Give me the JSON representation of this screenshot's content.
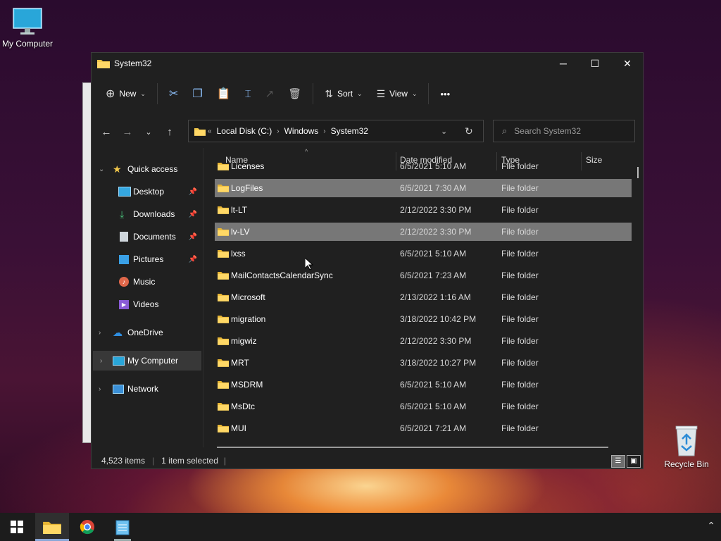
{
  "desktop": {
    "my_computer_label": "My Computer",
    "recycle_bin_label": "Recycle Bin"
  },
  "window": {
    "title": "System32",
    "minimize": "─",
    "maximize": "☐",
    "close": "✕"
  },
  "toolbar": {
    "new_label": "New",
    "sort_label": "Sort",
    "view_label": "View",
    "more": "•••"
  },
  "address": {
    "overflow": "«",
    "crumbs": [
      "Local Disk (C:)",
      "Windows",
      "System32"
    ]
  },
  "search": {
    "placeholder": "Search System32"
  },
  "sidebar": {
    "quick_access": "Quick access",
    "items": [
      {
        "label": "Desktop",
        "pinned": true
      },
      {
        "label": "Downloads",
        "pinned": true
      },
      {
        "label": "Documents",
        "pinned": true
      },
      {
        "label": "Pictures",
        "pinned": true
      },
      {
        "label": "Music",
        "pinned": false
      },
      {
        "label": "Videos",
        "pinned": false
      }
    ],
    "onedrive": "OneDrive",
    "my_computer": "My Computer",
    "network": "Network"
  },
  "columns": {
    "name": "Name",
    "date": "Date modified",
    "type": "Type",
    "size": "Size"
  },
  "files": [
    {
      "name": "Licenses",
      "date": "6/5/2021 5:10 AM",
      "type": "File folder"
    },
    {
      "name": "LogFiles",
      "date": "6/5/2021 7:30 AM",
      "type": "File folder",
      "selected": true
    },
    {
      "name": "lt-LT",
      "date": "2/12/2022 3:30 PM",
      "type": "File folder"
    },
    {
      "name": "lv-LV",
      "date": "2/12/2022 3:30 PM",
      "type": "File folder",
      "hovered": true
    },
    {
      "name": "lxss",
      "date": "6/5/2021 5:10 AM",
      "type": "File folder"
    },
    {
      "name": "MailContactsCalendarSync",
      "date": "6/5/2021 7:23 AM",
      "type": "File folder"
    },
    {
      "name": "Microsoft",
      "date": "2/13/2022 1:16 AM",
      "type": "File folder"
    },
    {
      "name": "migration",
      "date": "3/18/2022 10:42 PM",
      "type": "File folder"
    },
    {
      "name": "migwiz",
      "date": "2/12/2022 3:30 PM",
      "type": "File folder"
    },
    {
      "name": "MRT",
      "date": "3/18/2022 10:27 PM",
      "type": "File folder"
    },
    {
      "name": "MSDRM",
      "date": "6/5/2021 5:10 AM",
      "type": "File folder"
    },
    {
      "name": "MsDtc",
      "date": "6/5/2021 5:10 AM",
      "type": "File folder"
    },
    {
      "name": "MUI",
      "date": "6/5/2021 7:21 AM",
      "type": "File folder"
    }
  ],
  "status": {
    "items": "4,523 items",
    "selected": "1 item selected"
  },
  "colors": {
    "folder": "#f2c84b",
    "accent": "#8fc3ff"
  }
}
